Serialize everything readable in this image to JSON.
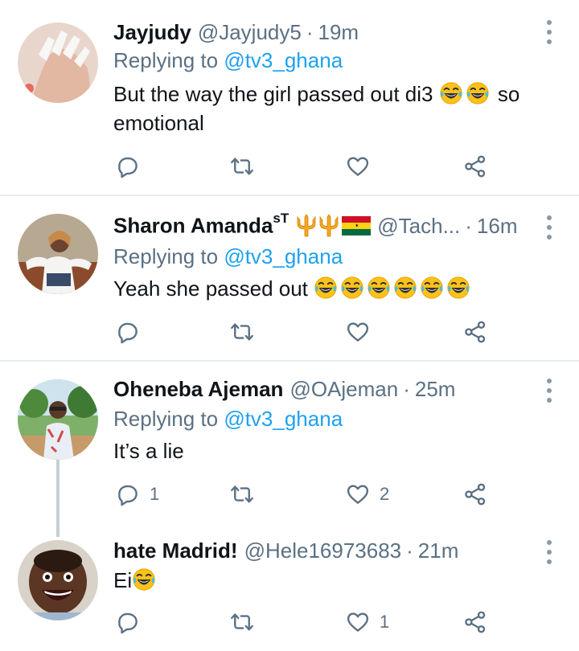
{
  "tweets": [
    {
      "name": "Jayjudy",
      "name_sup": "",
      "handle": "@Jayjudy5",
      "dot": "·",
      "time": "19m",
      "replying_prefix": "Replying to ",
      "replying_to": "@tv3_ghana",
      "text_main": "But the way the girl passed out di3 ",
      "text_after": " so",
      "text_line2": "emotional",
      "emoji_count": 2,
      "reply_count": "",
      "like_count": ""
    },
    {
      "name": "Sharon Amanda",
      "name_sup": "sT",
      "handle": "@Tach...",
      "dot": "·",
      "time": "16m",
      "replying_prefix": "Replying to ",
      "replying_to": "@tv3_ghana",
      "text_main": "Yeah she passed out ",
      "emoji_count": 6,
      "reply_count": "",
      "like_count": ""
    },
    {
      "name": "Oheneba Ajeman",
      "handle": "@OAjeman",
      "dot": "·",
      "time": "25m",
      "replying_prefix": "Replying to ",
      "replying_to": "@tv3_ghana",
      "text_main": "It’s a lie",
      "reply_count": "1",
      "like_count": "2"
    },
    {
      "name": "hate Madrid!",
      "handle": "@Hele16973683",
      "dot": "·",
      "time": "21m",
      "text_main": "Ei",
      "emoji_count": 1,
      "reply_count": "",
      "like_count": "1"
    }
  ],
  "colors": {
    "mention": "#1da1f2",
    "secondary_text": "#5b7083",
    "icon": "#5b7083",
    "divider": "#e6ecf0",
    "thread_line": "#c4cfd6"
  },
  "icons": [
    "reply-icon",
    "retweet-icon",
    "like-icon",
    "share-icon",
    "more-options-icon",
    "laughing-emoji",
    "trident-emoji",
    "ghana-flag-emoji"
  ]
}
